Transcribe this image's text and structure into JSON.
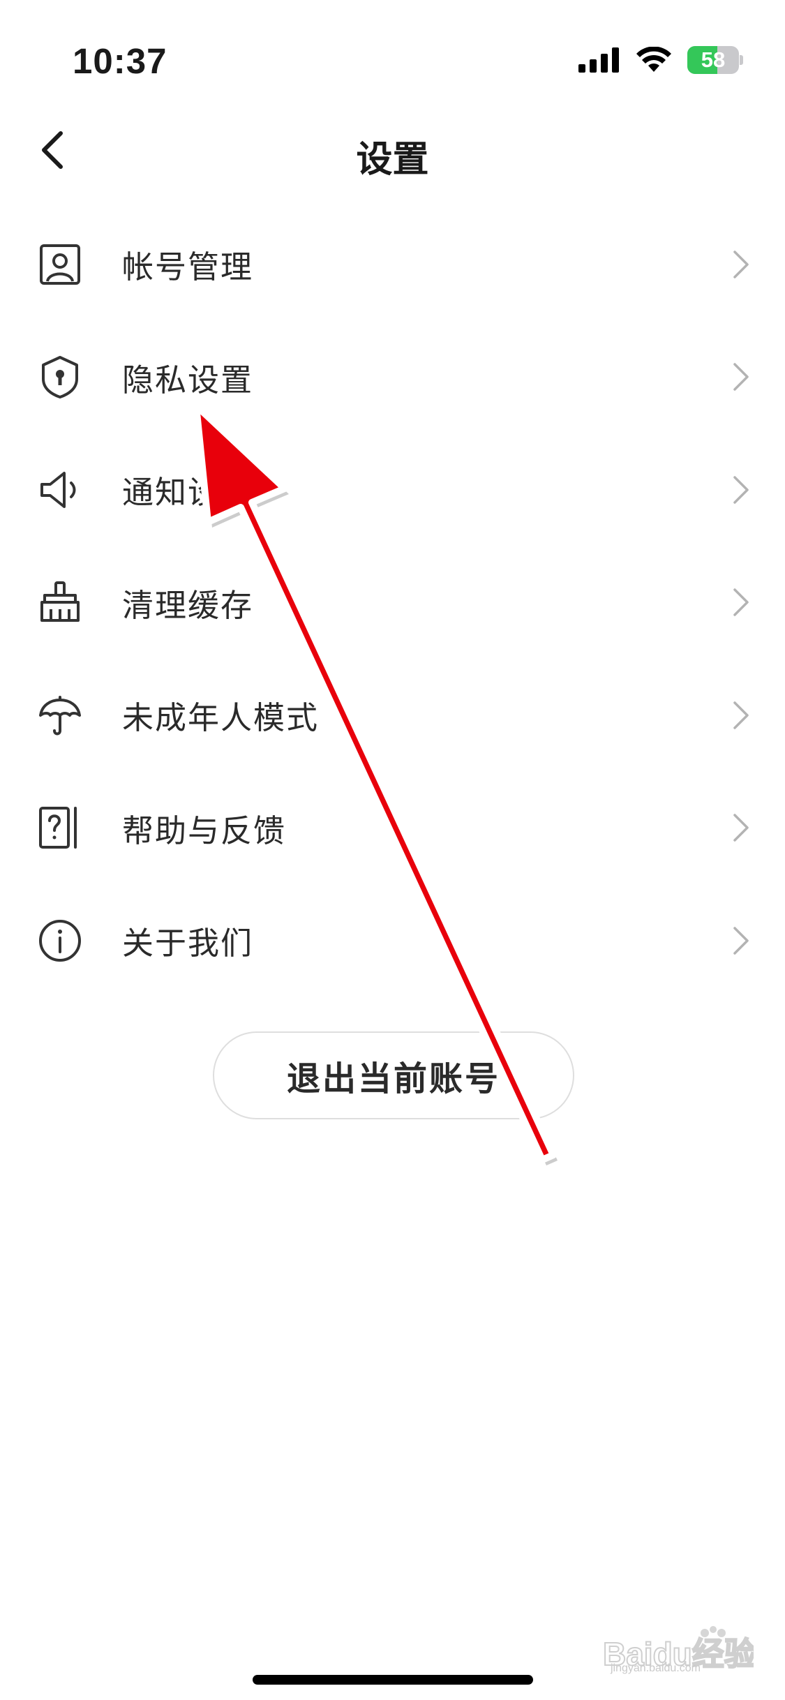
{
  "status_bar": {
    "time": "10:37",
    "battery_percent": "58",
    "battery_level": 0.58,
    "battery_color": "#34c759"
  },
  "nav": {
    "title": "设置",
    "back_icon": "chevron-left-icon"
  },
  "menu": {
    "items": [
      {
        "label": "帐号管理",
        "icon": "user-card-icon"
      },
      {
        "label": "隐私设置",
        "icon": "shield-keyhole-icon"
      },
      {
        "label": "通知设置",
        "icon": "speaker-icon"
      },
      {
        "label": "清理缓存",
        "icon": "broom-icon"
      },
      {
        "label": "未成年人模式",
        "icon": "umbrella-icon"
      },
      {
        "label": "帮助与反馈",
        "icon": "help-question-icon"
      },
      {
        "label": "关于我们",
        "icon": "info-icon"
      }
    ]
  },
  "logout": {
    "label": "退出当前账号"
  },
  "annotation": {
    "arrow_color": "#e8000b"
  },
  "watermark": {
    "text": "Baidu经验",
    "domain": "jingyan.baidu.com"
  }
}
